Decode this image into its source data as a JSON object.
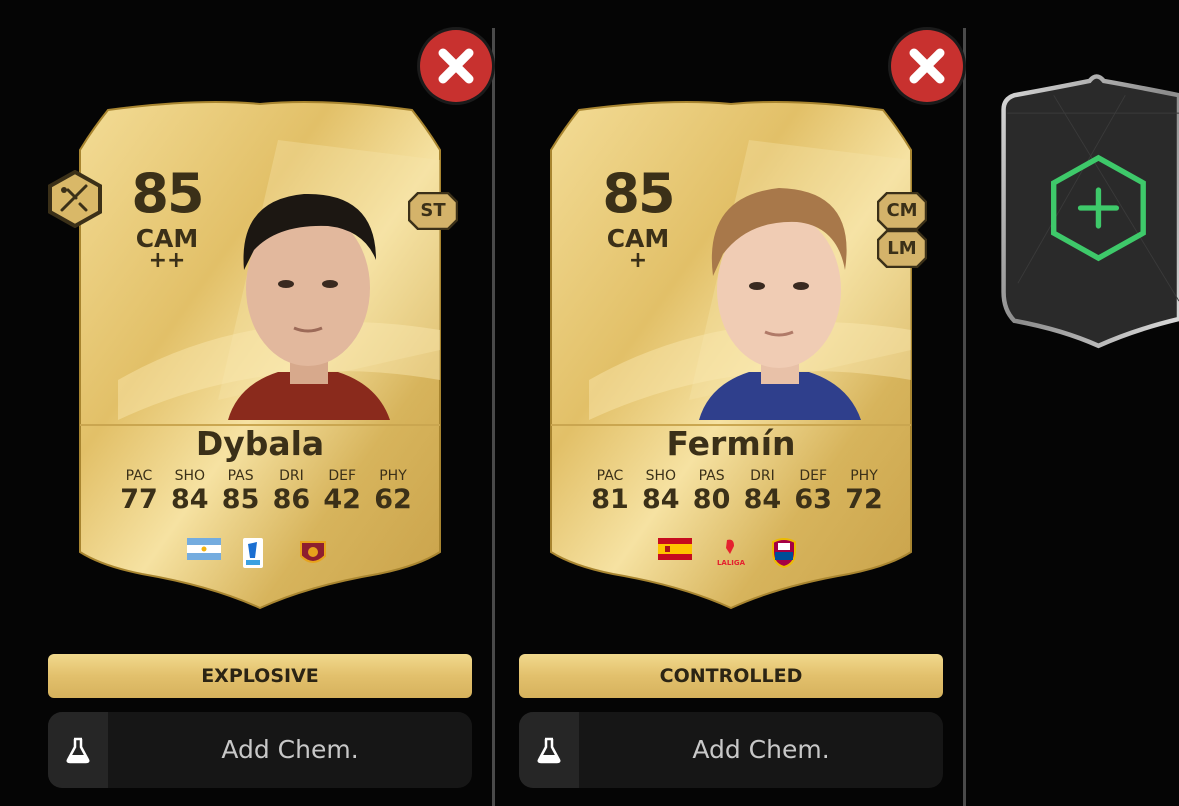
{
  "cards": [
    {
      "rating": "85",
      "position": "CAM",
      "plus": "++",
      "alt_positions": [
        "ST"
      ],
      "name": "Dybala",
      "stats": [
        {
          "label": "PAC",
          "value": "77"
        },
        {
          "label": "SHO",
          "value": "84"
        },
        {
          "label": "PAS",
          "value": "85"
        },
        {
          "label": "DRI",
          "value": "86"
        },
        {
          "label": "DEF",
          "value": "42"
        },
        {
          "label": "PHY",
          "value": "62"
        }
      ],
      "playstyle": "EXPLOSIVE",
      "chem_label": "Add Chem.",
      "nation_icon": "argentina-flag-icon",
      "league_icon": "serie-a-icon",
      "club_icon": "as-roma-icon"
    },
    {
      "rating": "85",
      "position": "CAM",
      "plus": "+",
      "alt_positions": [
        "CM",
        "LM"
      ],
      "name": "Fermín",
      "stats": [
        {
          "label": "PAC",
          "value": "81"
        },
        {
          "label": "SHO",
          "value": "84"
        },
        {
          "label": "PAS",
          "value": "80"
        },
        {
          "label": "DRI",
          "value": "84"
        },
        {
          "label": "DEF",
          "value": "63"
        },
        {
          "label": "PHY",
          "value": "72"
        }
      ],
      "playstyle": "CONTROLLED",
      "chem_label": "Add Chem.",
      "nation_icon": "spain-flag-icon",
      "league_icon": "laliga-icon",
      "league_text": "LALIGA",
      "club_icon": "fc-barcelona-icon"
    }
  ],
  "colors": {
    "gold": "#e2c36f",
    "gold_dark": "#b8912f",
    "text_dark": "#3b3018",
    "remove": "#c8312f",
    "add_green": "#3ec96a"
  },
  "icons": {
    "remove": "close-x-icon",
    "chem": "flask-icon",
    "add": "plus-hexagon-icon",
    "playstyle_plus": "playmaker-tactic-icon"
  }
}
